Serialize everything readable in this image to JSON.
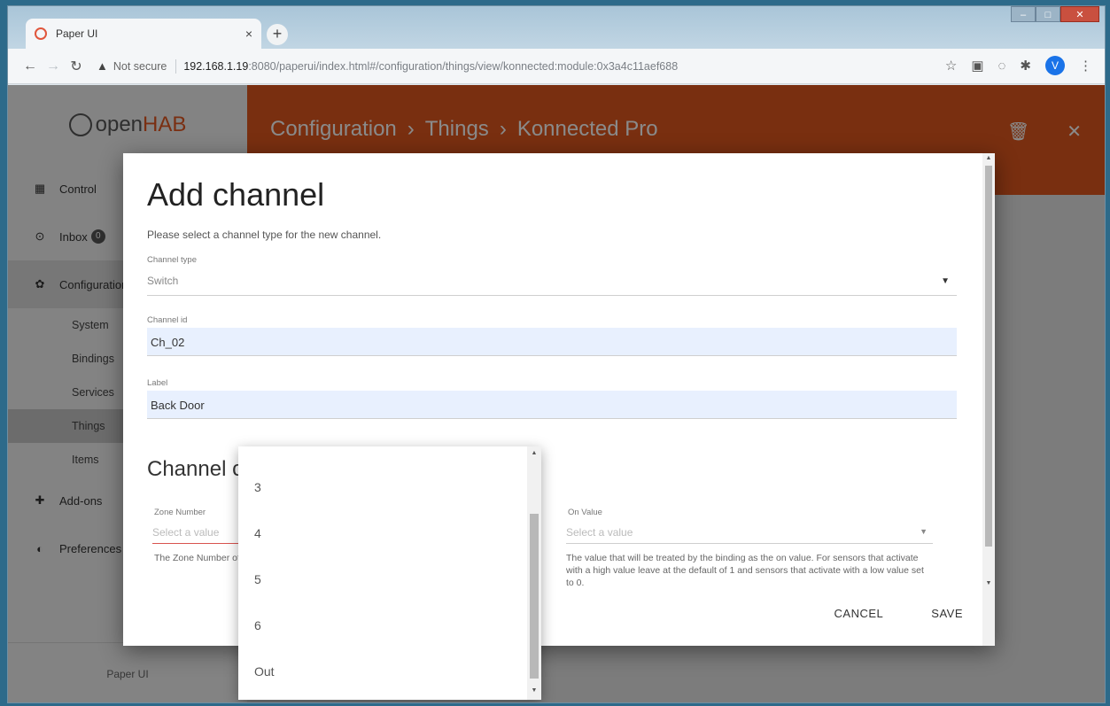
{
  "browser": {
    "tab_title": "Paper UI",
    "tab_close": "×",
    "new_tab": "+",
    "security_label": "Not secure",
    "url_host": "192.168.1.19",
    "url_path": ":8080/paperui/index.html#/configuration/things/view/konnected:module:0x3a4c11aef688",
    "profile_initial": "V"
  },
  "sidebar": {
    "brand_prefix": "open",
    "brand_suffix": "HAB",
    "items": [
      {
        "label": "Control"
      },
      {
        "label": "Inbox",
        "badge": "0"
      },
      {
        "label": "Configuration"
      }
    ],
    "sub_items": [
      "System",
      "Bindings",
      "Services",
      "Things",
      "Items"
    ],
    "bottom_items": [
      {
        "label": "Add-ons"
      },
      {
        "label": "Preferences"
      }
    ],
    "footer": "Paper UI"
  },
  "header": {
    "breadcrumb": [
      "Configuration",
      "Things",
      "Konnected Pro"
    ],
    "separator": "›"
  },
  "dialog": {
    "title": "Add channel",
    "description": "Please select a channel type for the new channel.",
    "channel_type_label": "Channel type",
    "channel_type_value": "Switch",
    "channel_id_label": "Channel id",
    "channel_id_value": "Ch_02",
    "label_label": "Label",
    "label_value": "Back Door",
    "section_title": "Channel configuration",
    "zone_label": "Zone Number",
    "zone_placeholder": "Select a value",
    "zone_helper": "The Zone Number of the channel.",
    "on_value_label": "On Value",
    "on_value_placeholder": "Select a value",
    "on_value_helper": "The value that will be treated by the binding as the on value. For sensors that activate with a high value leave at the default of 1 and sensors that activate with a low value set to 0.",
    "cancel": "CANCEL",
    "save": "SAVE"
  },
  "dropdown": {
    "options": [
      "3",
      "4",
      "5",
      "6",
      "Out"
    ]
  },
  "colors": {
    "brand": "#e0581e",
    "autofill": "#e8f0fe",
    "error": "#d9534f"
  }
}
